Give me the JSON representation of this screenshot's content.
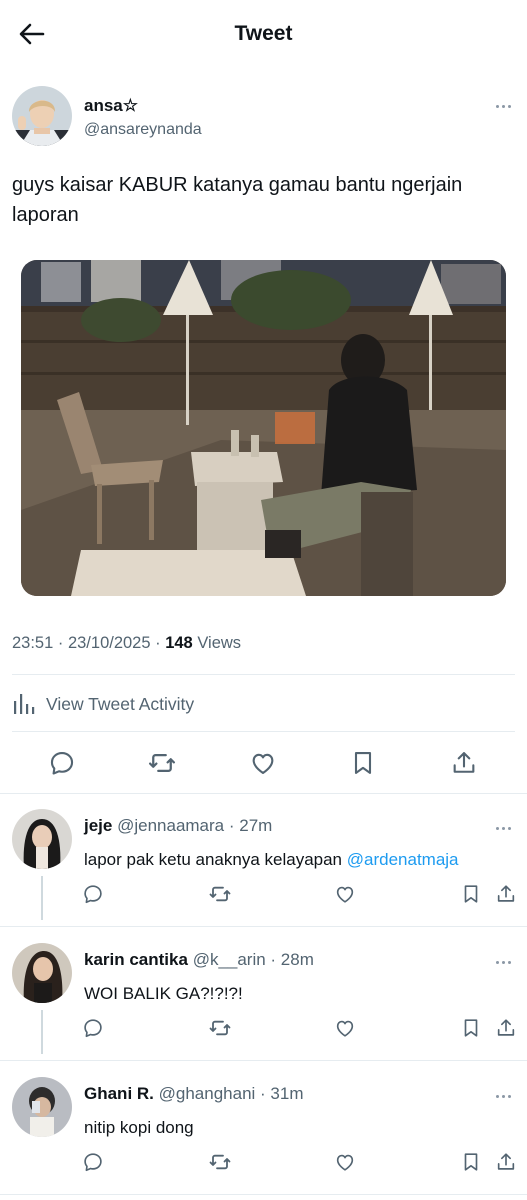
{
  "header": {
    "title": "Tweet",
    "back_icon": "arrow-left-icon"
  },
  "tweet": {
    "author_name": "ansa☆",
    "author_handle": "@ansareynanda",
    "text": "guys kaisar KABUR katanya gamau bantu ngerjain laporan",
    "time": "23:51 · 23/10/2025 · ",
    "views_count": "148",
    "views_label": " Views",
    "activity_label": "View Tweet Activity"
  },
  "actions": {
    "icons": [
      "reply-icon",
      "retweet-icon",
      "like-icon",
      "bookmark-icon",
      "share-icon"
    ]
  },
  "replies": [
    {
      "name": "jeje",
      "handle": "@jennaamara · 27m",
      "text": "lapor pak ketu anaknya kelayapan ",
      "mention": "@ardenatmaja"
    },
    {
      "name": "karin cantika",
      "handle": "@k__arin · 28m",
      "text": "WOI BALIK GA?!?!?!",
      "mention": ""
    },
    {
      "name": "Ghani R.",
      "handle": "@ghanghani · 31m",
      "text": "nitip kopi dong",
      "mention": ""
    }
  ],
  "colors": {
    "text": "#0f1419",
    "secondary": "#536471",
    "link": "#1d9bf0",
    "divider": "#e6ecf0"
  }
}
